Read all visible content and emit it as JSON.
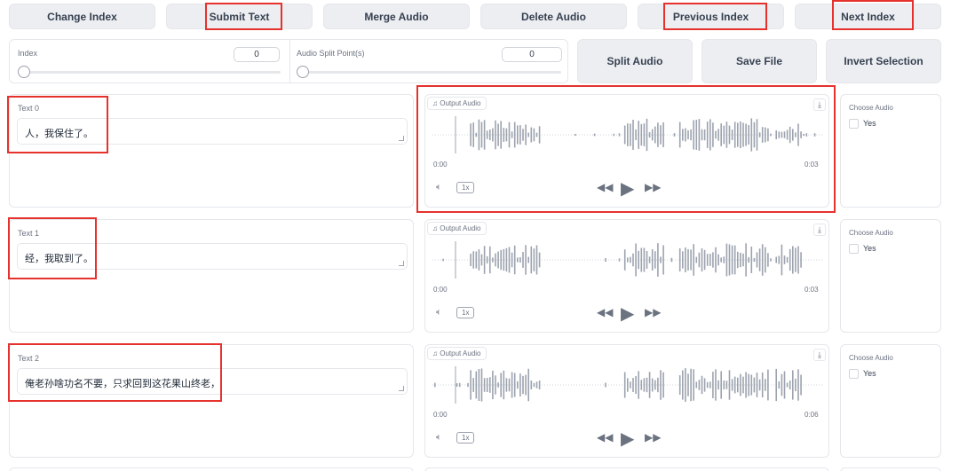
{
  "toolbar": {
    "change_index": "Change Index",
    "submit_text": "Submit Text",
    "merge_audio": "Merge Audio",
    "delete_audio": "Delete Audio",
    "previous_index": "Previous Index",
    "next_index": "Next Index"
  },
  "controls": {
    "index_label": "Index",
    "index_value": "0",
    "split_label": "Audio Split Point(s)",
    "split_value": "0",
    "split_audio": "Split Audio",
    "save_file": "Save File",
    "invert_selection": "Invert Selection"
  },
  "rows": [
    {
      "text_label": "Text 0",
      "text": "人，我保住了。",
      "audio_label": "Output Audio",
      "time_start": "0:00",
      "time_end": "0:03",
      "speed": "1x",
      "choose_label": "Choose Audio",
      "choose_option": "Yes"
    },
    {
      "text_label": "Text 1",
      "text": "经，我取到了。",
      "audio_label": "Output Audio",
      "time_start": "0:00",
      "time_end": "0:03",
      "speed": "1x",
      "choose_label": "Choose Audio",
      "choose_option": "Yes"
    },
    {
      "text_label": "Text 2",
      "text": "俺老孙啥功名不要，只求回到这花果山终老，",
      "audio_label": "Output Audio",
      "time_start": "0:00",
      "time_end": "0:06",
      "speed": "1x",
      "choose_label": "Choose Audio",
      "choose_option": "Yes"
    }
  ],
  "icons": {
    "music": "music-note-icon",
    "download": "download-icon",
    "volume": "volume-icon",
    "rewind": "rewind-icon",
    "play": "play-icon",
    "forward": "fast-forward-icon"
  },
  "colors": {
    "highlight": "#e5322d",
    "played": "#f97316",
    "wave": "#9ca3af"
  }
}
